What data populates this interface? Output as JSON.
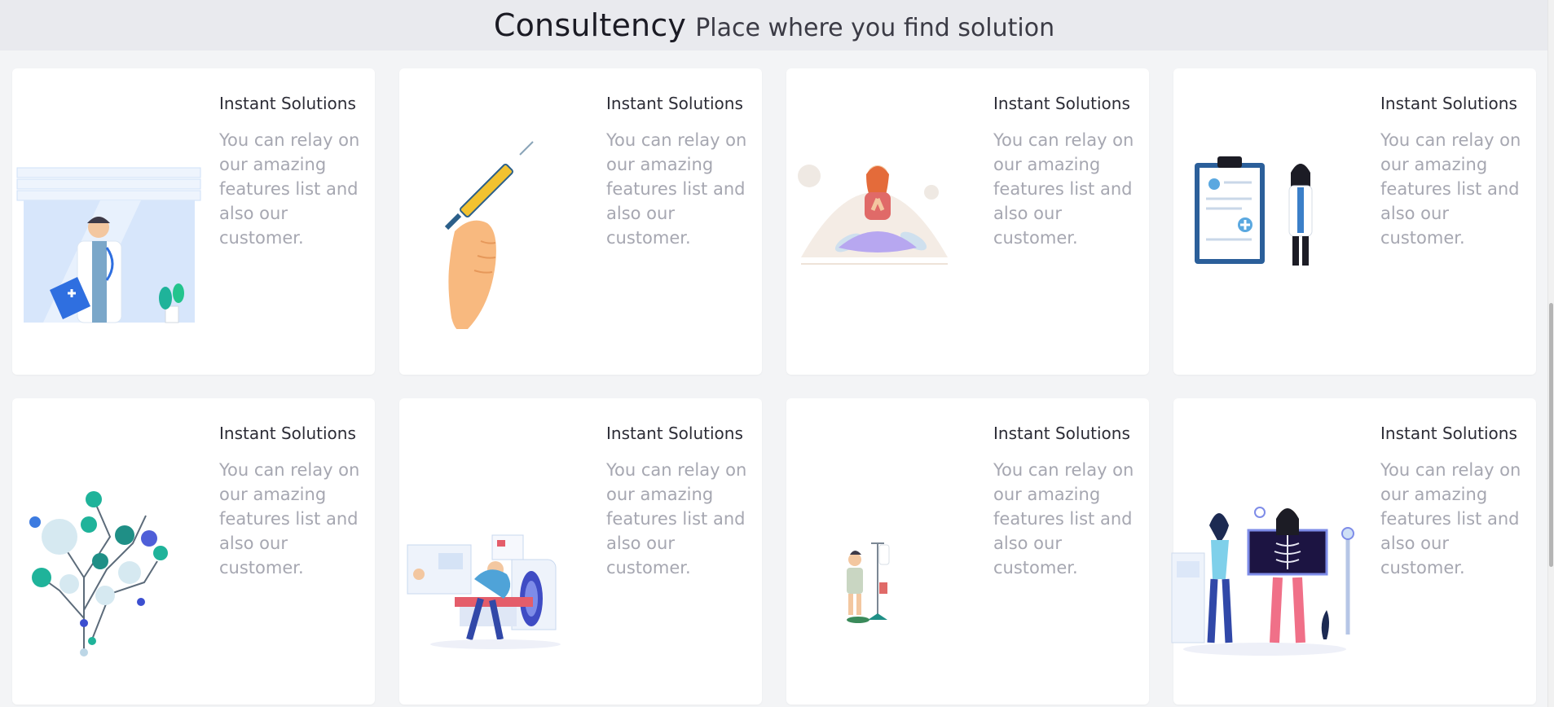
{
  "header": {
    "brand": "Consultency",
    "tagline": "Place where you find solution"
  },
  "cards": [
    {
      "title": "Instant Solutions",
      "description": "You can relay on our amazing features list and also our customer.",
      "illustration": "doctor-clipboard-illustration"
    },
    {
      "title": "Instant Solutions",
      "description": "You can relay on our amazing features list and also our customer.",
      "illustration": "syringe-hand-illustration"
    },
    {
      "title": "Instant Solutions",
      "description": "You can relay on our amazing features list and also our customer.",
      "illustration": "meditation-illustration"
    },
    {
      "title": "Instant Solutions",
      "description": "You can relay on our amazing features list and also our customer.",
      "illustration": "medical-report-illustration"
    },
    {
      "title": "Instant Solutions",
      "description": "You can relay on our amazing features list and also our customer.",
      "illustration": "medical-network-illustration"
    },
    {
      "title": "Instant Solutions",
      "description": "You can relay on our amazing features list and also our customer.",
      "illustration": "mri-scan-illustration"
    },
    {
      "title": "Instant Solutions",
      "description": "You can relay on our amazing features list and also our customer.",
      "illustration": "iv-patient-illustration"
    },
    {
      "title": "Instant Solutions",
      "description": "You can relay on our amazing features list and also our customer.",
      "illustration": "xray-illustration"
    }
  ],
  "colors": {
    "page_bg": "#f3f4f6",
    "header_bg": "#e9eaee",
    "card_bg": "#ffffff",
    "title": "#2c2c36",
    "description": "#a6a7b1",
    "accent_blue": "#2f6fe0",
    "accent_teal": "#1fb39a"
  }
}
